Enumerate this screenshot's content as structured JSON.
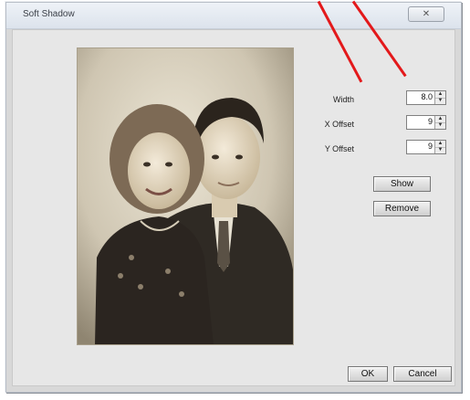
{
  "window": {
    "title": "Soft Shadow",
    "close_glyph": "✕"
  },
  "photo": {
    "description_icon": "portrait-photo"
  },
  "fields": {
    "width": {
      "label": "Width",
      "value": "8.0"
    },
    "x_offset": {
      "label": "X Offset",
      "value": "9"
    },
    "y_offset": {
      "label": "Y Offset",
      "value": "9"
    }
  },
  "buttons": {
    "show": "Show",
    "remove": "Remove",
    "ok": "OK",
    "cancel": "Cancel"
  },
  "spinner": {
    "up_glyph": "▲",
    "down_glyph": "▼"
  },
  "colors": {
    "annotation_arrow": "#e3191b",
    "dialog_bg": "#d8d8d8",
    "photo_sepia": "#d4cdbd"
  }
}
